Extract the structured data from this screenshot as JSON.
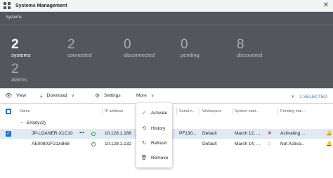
{
  "window": {
    "title": "Systems Management",
    "close_glyph": "✕"
  },
  "hero": {
    "section_title": "Systems",
    "stats": [
      {
        "value": "2",
        "label": "systems"
      },
      {
        "value": "2",
        "label": "connected"
      },
      {
        "value": "0",
        "label": "disconnected"
      },
      {
        "value": "0",
        "label": "pending"
      },
      {
        "value": "8",
        "label": "discovered"
      },
      {
        "value": "2",
        "label": "alarms"
      }
    ]
  },
  "toolbar": {
    "view_label": "View",
    "download_label": "Download",
    "settings_label": "Settings",
    "more_label": "More",
    "selected_label": "1 SELECTED"
  },
  "table": {
    "headers": {
      "name": "Name",
      "ip": "IP address",
      "serial": "Serial n...",
      "workspace": "Workspace",
      "system_start": "System start...",
      "pending_start": "Pending stat..."
    },
    "group_label": "Empty",
    "group_count": "(2)",
    "rows": [
      {
        "name": "JP-LOANER-X1C10",
        "ip": "10.128.1.166",
        "serial": "PF130...",
        "workspace": "Default",
        "system_start": "March 12, ...",
        "pending": "Activating ...",
        "selected": true,
        "pending_icon": "x-mark-icon"
      },
      {
        "name": "AE00802F21AB68",
        "ip": "10.128.1.132",
        "serial": "",
        "workspace": "Default",
        "system_start": "March 14, ...",
        "pending": "Not Activa...",
        "selected": false,
        "pending_icon": "warning-icon"
      }
    ]
  },
  "more_menu": {
    "items": [
      {
        "label": "Activate",
        "icon": "check-icon"
      },
      {
        "label": "History",
        "icon": "history-icon"
      },
      {
        "label": "Refresh",
        "icon": "refresh-icon"
      },
      {
        "label": "Remove",
        "icon": "trash-icon"
      }
    ]
  },
  "colors": {
    "accent": "#1a78c2",
    "hero_bg": "#53565b",
    "ok": "#1f9e3a",
    "error": "#c62828",
    "warning": "#e6a317",
    "bell": "#e0822b"
  }
}
